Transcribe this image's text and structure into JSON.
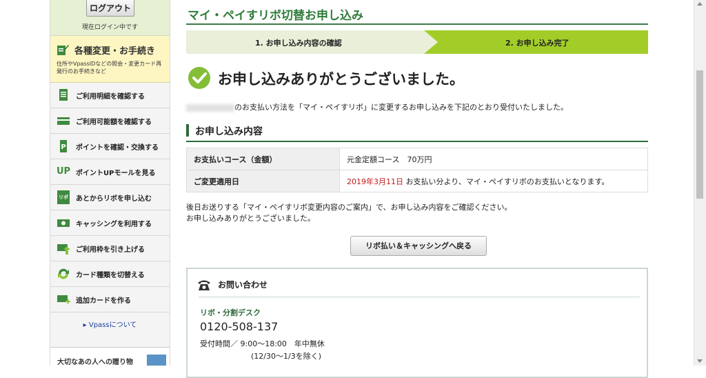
{
  "sidebar": {
    "logout_label": "ログアウト",
    "login_status": "現在ログイン中です",
    "procedures": {
      "title": "各種変更・お手続き",
      "desc": "住所やVpassIDなどの照会・変更カード再発行のお手続きなど"
    },
    "items": [
      {
        "label": "ご利用明細を確認する",
        "icon": "statement-icon"
      },
      {
        "label": "ご利用可能額を確認する",
        "icon": "card-icon"
      },
      {
        "label": "ポイントを確認・交換する",
        "icon": "points-icon"
      },
      {
        "label": "ポイントUPモールを見る",
        "icon": "up-mall-icon",
        "icon_text": "UP"
      },
      {
        "label": "あとからリボを申し込む",
        "icon": "revolving-bag-icon",
        "icon_text": "リボ"
      },
      {
        "label": "キャッシングを利用する",
        "icon": "cash-icon"
      },
      {
        "label": "ご利用枠を引き上げる",
        "icon": "limit-up-icon"
      },
      {
        "label": "カード種類を切替える",
        "icon": "switch-card-icon"
      },
      {
        "label": "追加カードを作る",
        "icon": "add-card-icon"
      }
    ],
    "vpass_link": "▸ Vpassについて",
    "gift_text": "大切なあの人への贈り物"
  },
  "main": {
    "title": "マイ・ペイすリボ切替お申し込み",
    "steps": [
      {
        "label": "1. お申し込み内容の確認"
      },
      {
        "label": "2. お申し込み完了"
      }
    ],
    "thanks": "お申し込みありがとうございました。",
    "notice": "のお支払い方法を「マイ・ペイすリボ」に変更するお申し込みを下記のとおり受付いたしました。",
    "section_title": "お申し込み内容",
    "table": [
      {
        "label": "お支払いコース（金額）",
        "value": "元金定額コース　70万円",
        "highlight": ""
      },
      {
        "label": "ご変更適用日",
        "highlight": "2019年3月11日",
        "value": " お支払い分より、マイ・ペイすリボのお支払いとなります。"
      }
    ],
    "after_note_1": "後日お送りする「マイ・ペイすリボ変更内容のご案内」で、お申し込み内容をご確認ください。",
    "after_note_2": "お申し込みありがとうございました。",
    "back_button": "リボ払い＆キャッシングへ戻る",
    "contact": {
      "title": "お問い合わせ",
      "desk": "リボ・分割デスク",
      "phone": "0120-508-137",
      "hours": "受付時間／ 9:00～18:00　年中無休",
      "note": "(12/30～1/3を除く)"
    }
  },
  "colors": {
    "accent_green": "#2f7c3b",
    "step_active": "#a2cd28",
    "step_inactive": "#e9efd9",
    "highlight_red": "#c31a1a"
  }
}
